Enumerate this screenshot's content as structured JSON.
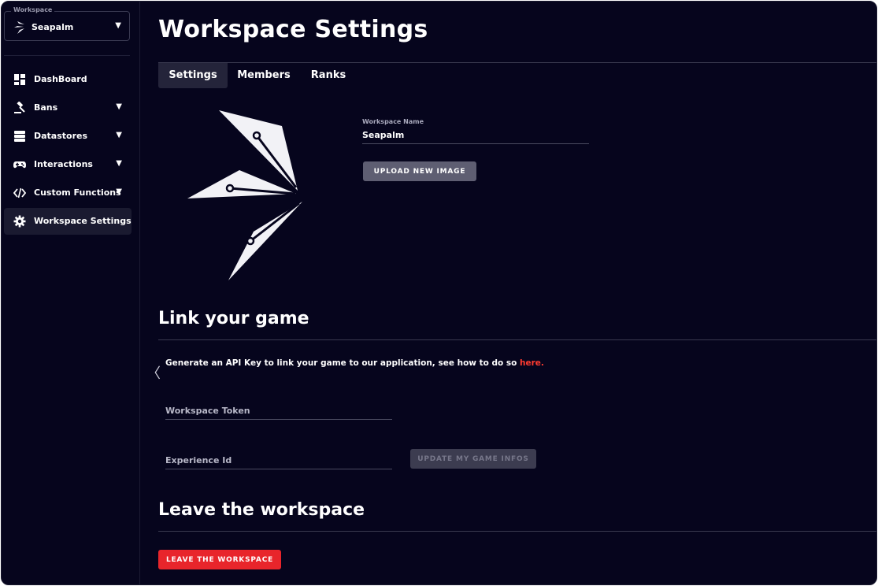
{
  "sidebar": {
    "workspace_label": "Workspace",
    "workspace_name": "Seapalm",
    "items": [
      {
        "label": "DashBoard",
        "icon": "dashboard-icon"
      },
      {
        "label": "Bans",
        "icon": "gavel-icon"
      },
      {
        "label": "Datastores",
        "icon": "database-icon"
      },
      {
        "label": "Interactions",
        "icon": "gamepad-icon"
      },
      {
        "label": "Custom Functions",
        "icon": "code-icon"
      },
      {
        "label": "Workspace Settings",
        "icon": "gear-icon"
      }
    ],
    "caret": "▼",
    "collapse": "〈"
  },
  "header": {
    "title": "Workspace Settings"
  },
  "tabs": [
    {
      "label": "Settings",
      "active": true
    },
    {
      "label": "Members",
      "active": false
    },
    {
      "label": "Ranks",
      "active": false
    }
  ],
  "settings": {
    "name_label": "Workspace Name",
    "name_value": "Seapalm",
    "upload_button": "UPLOAD NEW IMAGE"
  },
  "link_game": {
    "title": "Link your game",
    "description": "Generate an API Key to link your game to our application, see how to do so ",
    "link_text": "here.",
    "token_placeholder": "Workspace Token",
    "experience_placeholder": "Experience Id",
    "update_button": "UPDATE MY GAME INFOS"
  },
  "leave": {
    "title": "Leave the workspace",
    "button": "LEAVE THE WORKSPACE"
  },
  "colors": {
    "background": "#06051d",
    "accent_red": "#e8252b",
    "link_red": "#ff3b30"
  }
}
